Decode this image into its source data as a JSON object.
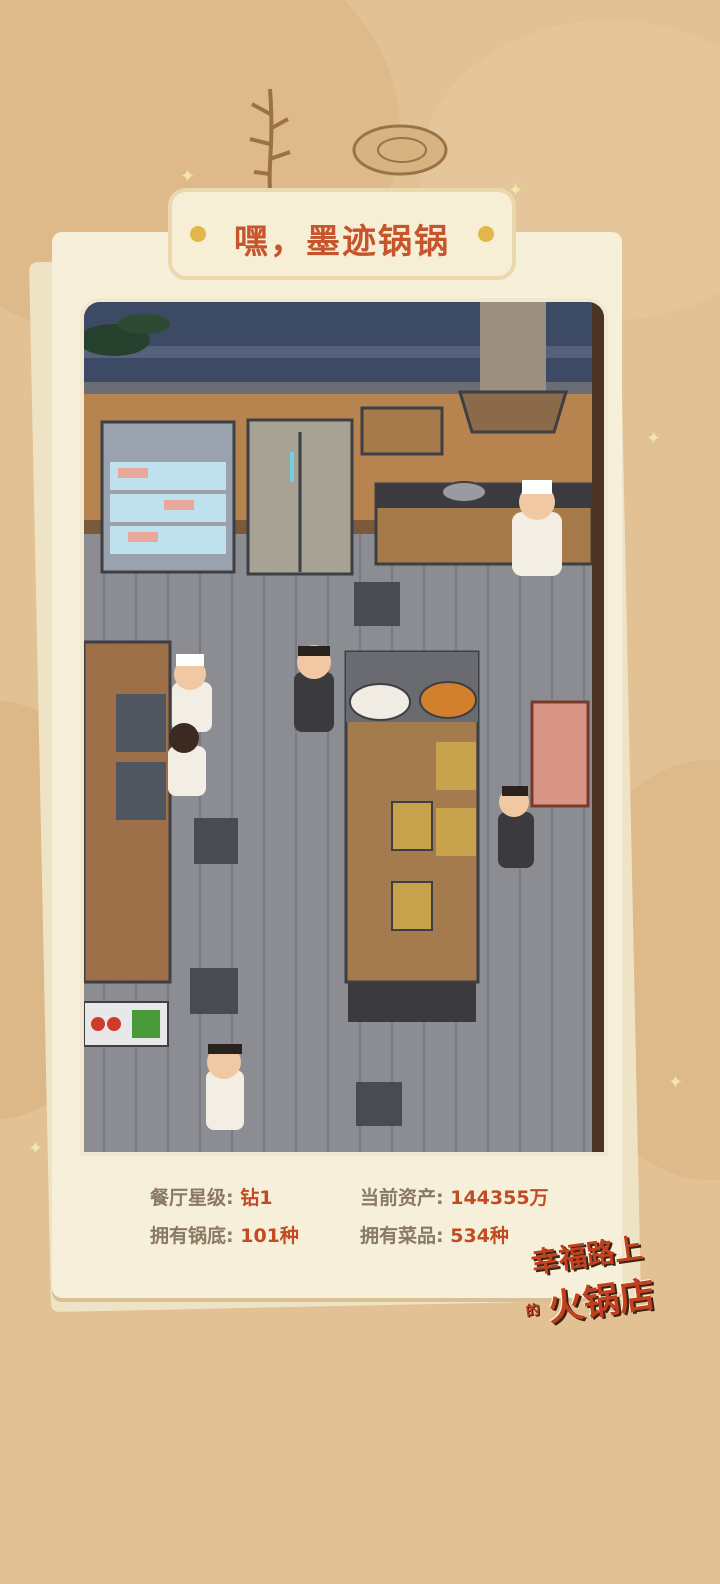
{
  "title": "嘿，墨迹锅锅",
  "stats": {
    "star_label": "餐厅星级:",
    "star_value": "钻1",
    "assets_label": "当前资产:",
    "assets_value": "144355万",
    "bases_label": "拥有锅底:",
    "bases_value": "101种",
    "dishes_label": "拥有菜品:",
    "dishes_value": "534种"
  },
  "logo": {
    "line1": "幸福路上",
    "de": "的",
    "line2": "火锅店"
  },
  "colors": {
    "background": "#e2c194",
    "title_text": "#c7552c",
    "stat_value": "#c14b23",
    "stat_label": "#8a7a64"
  }
}
